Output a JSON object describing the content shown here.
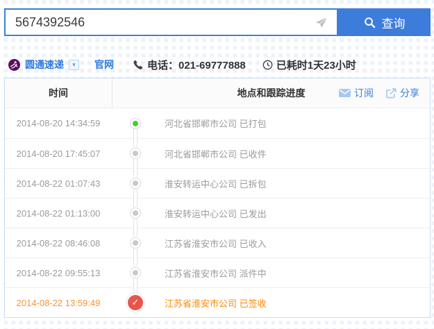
{
  "search": {
    "value": "5674392546",
    "button_label": "查询"
  },
  "courier": {
    "name": "圆通速递",
    "website_label": "官网",
    "phone": "电话：021-69777888",
    "elapsed": "已耗时1天23小时"
  },
  "table": {
    "header_time": "时间",
    "header_progress": "地点和跟踪进度",
    "subscribe_label": "订阅",
    "share_label": "分享",
    "rows": [
      {
        "time": "2014-08-20 14:34:59",
        "text": "河北省邯郸市公司 已打包",
        "marker": "green",
        "highlight": false
      },
      {
        "time": "2014-08-20 17:45:07",
        "text": "河北省邯郸市公司 已收件",
        "marker": "gray",
        "highlight": false
      },
      {
        "time": "2014-08-22 01:07:43",
        "text": "淮安转运中心公司 已拆包",
        "marker": "gray",
        "highlight": false
      },
      {
        "time": "2014-08-22 01:13:00",
        "text": "淮安转运中心公司 已发出",
        "marker": "gray",
        "highlight": false
      },
      {
        "time": "2014-08-22 08:46:08",
        "text": "江苏省淮安市公司 已收入",
        "marker": "gray",
        "highlight": false
      },
      {
        "time": "2014-08-22 09:55:13",
        "text": "江苏省淮安市公司 派件中",
        "marker": "gray",
        "highlight": false
      },
      {
        "time": "2014-08-22 13:59:49",
        "text": "江苏省淮安市公司 已签收",
        "marker": "check",
        "highlight": true
      }
    ]
  },
  "icons": {
    "check": "✓",
    "caret_down": "▾"
  },
  "colors": {
    "accent_blue": "#3c7cdb",
    "link_blue": "#3a7cd9",
    "highlight_orange": "#ff8800",
    "signed_red": "#e7564c",
    "delivered_green": "#46cf2b",
    "logo_purple": "#5a1060",
    "table_border_blue": "#c6dcf2"
  }
}
